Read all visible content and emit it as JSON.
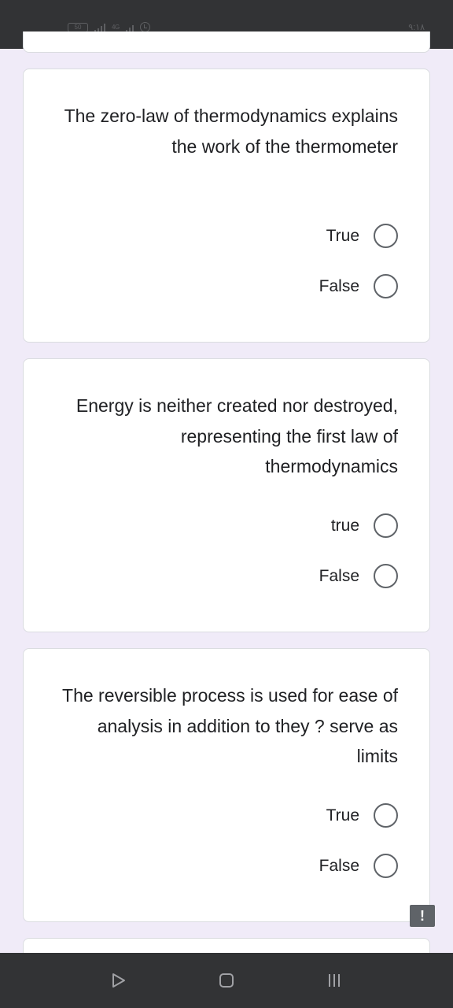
{
  "status_bar": {
    "battery_level": "50",
    "network_label": "4G",
    "time": "٩:١٨"
  },
  "questions": [
    {
      "text": "The zero-law of thermodynamics explains the work of the thermometer",
      "options": [
        "True",
        "False"
      ]
    },
    {
      "text": "Energy is neither created nor destroyed, representing the first law of thermodynamics",
      "options": [
        "true",
        "False"
      ]
    },
    {
      "text": "The reversible process is used for ease of analysis in addition to they ? serve as limits",
      "options": [
        "True",
        "False"
      ]
    }
  ],
  "feedback_badge": "!",
  "colors": {
    "background": "#f0ebf8",
    "card": "#ffffff",
    "system_bar": "#323335",
    "radio_border": "#5f6368"
  }
}
